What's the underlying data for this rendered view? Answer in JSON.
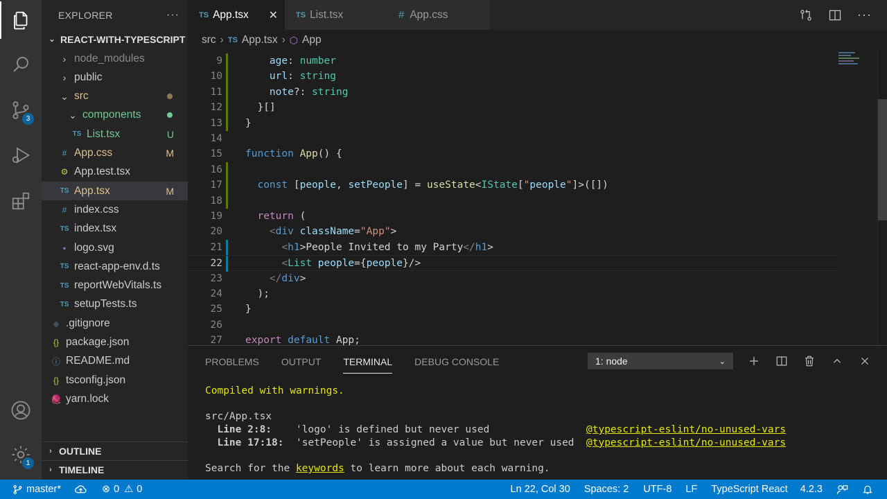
{
  "activity": {
    "scm_badge": "3",
    "settings_badge": "1"
  },
  "sidebar": {
    "title": "EXPLORER",
    "more": "···",
    "project": "REACT-WITH-TYPESCRIPT",
    "items": [
      {
        "label": "node_modules",
        "icon": "›",
        "color": "#8b8b8b",
        "status": ""
      },
      {
        "label": "public",
        "icon": "›",
        "color": "#cccccc",
        "status": ""
      },
      {
        "label": "src",
        "icon": "⌄",
        "color": "#e2c08d",
        "status": "dot"
      },
      {
        "label": "components",
        "icon": "⌄",
        "color": "#73c991",
        "status": "dot"
      },
      {
        "label": "List.tsx",
        "icon": "TS",
        "color": "#73c991",
        "status": "U"
      },
      {
        "label": "App.css",
        "icon": "#",
        "color": "#e2c08d",
        "status": "M"
      },
      {
        "label": "App.test.tsx",
        "icon": "⚙",
        "color": "#cccccc",
        "status": ""
      },
      {
        "label": "App.tsx",
        "icon": "TS",
        "color": "#e2c08d",
        "status": "M"
      },
      {
        "label": "index.css",
        "icon": "#",
        "color": "#cccccc",
        "status": ""
      },
      {
        "label": "index.tsx",
        "icon": "TS",
        "color": "#cccccc",
        "status": ""
      },
      {
        "label": "logo.svg",
        "icon": "▪",
        "color": "#cccccc",
        "status": ""
      },
      {
        "label": "react-app-env.d.ts",
        "icon": "TS",
        "color": "#cccccc",
        "status": ""
      },
      {
        "label": "reportWebVitals.ts",
        "icon": "TS",
        "color": "#cccccc",
        "status": ""
      },
      {
        "label": "setupTests.ts",
        "icon": "TS",
        "color": "#cccccc",
        "status": ""
      },
      {
        "label": ".gitignore",
        "icon": "◆",
        "color": "#cccccc",
        "status": ""
      },
      {
        "label": "package.json",
        "icon": "{}",
        "color": "#cccccc",
        "status": ""
      },
      {
        "label": "README.md",
        "icon": "ⓘ",
        "color": "#cccccc",
        "status": ""
      },
      {
        "label": "tsconfig.json",
        "icon": "{}",
        "color": "#cccccc",
        "status": ""
      },
      {
        "label": "yarn.lock",
        "icon": "🧶",
        "color": "#cccccc",
        "status": ""
      }
    ],
    "outline": "OUTLINE",
    "timeline": "TIMELINE"
  },
  "tabs": [
    {
      "label": "App.tsx",
      "prefix": "TS",
      "close": "✕"
    },
    {
      "label": "List.tsx",
      "prefix": "TS"
    },
    {
      "label": "App.css",
      "prefix": "#"
    }
  ],
  "breadcrumb": {
    "folder": "src",
    "file_prefix": "TS",
    "file": "App.tsx",
    "symbol": "App"
  },
  "editor": {
    "lines": [
      {
        "n": "9",
        "t": "    age: number"
      },
      {
        "n": "10",
        "t": "    url: string"
      },
      {
        "n": "11",
        "t": "    note?: string"
      },
      {
        "n": "12",
        "t": "  }[]"
      },
      {
        "n": "13",
        "t": "}"
      },
      {
        "n": "14",
        "t": ""
      },
      {
        "n": "15",
        "t": "function App() {"
      },
      {
        "n": "16",
        "t": ""
      },
      {
        "n": "17",
        "t": "  const [people, setPeople] = useState<IState[\"people\"]>([])"
      },
      {
        "n": "18",
        "t": ""
      },
      {
        "n": "19",
        "t": "  return ("
      },
      {
        "n": "20",
        "t": "    <div className=\"App\">"
      },
      {
        "n": "21",
        "t": "      <h1>People Invited to my Party</h1>"
      },
      {
        "n": "22",
        "t": "      <List people={people}/>"
      },
      {
        "n": "23",
        "t": "    </div>"
      },
      {
        "n": "24",
        "t": "  );"
      },
      {
        "n": "25",
        "t": "}"
      },
      {
        "n": "26",
        "t": ""
      },
      {
        "n": "27",
        "t": "export default App;"
      }
    ]
  },
  "panel": {
    "tabs": [
      "PROBLEMS",
      "OUTPUT",
      "TERMINAL",
      "DEBUG CONSOLE"
    ],
    "terminal_select": "1: node",
    "terminal": {
      "l1": "Compiled with warnings.",
      "l2": "src/App.tsx",
      "w1_loc": "  Line 2:8:  ",
      "w1_msg": "  'logo' is defined but never used                ",
      "w1_rule": "@typescript-eslint/no-unused-vars",
      "w2_loc": "  Line 17:18:",
      "w2_msg": "  'setPeople' is assigned a value but never used  ",
      "w2_rule": "@typescript-eslint/no-unused-vars",
      "l5a": "Search for the ",
      "l5b": "keywords",
      "l5c": " to learn more about each warning."
    }
  },
  "status": {
    "branch": "master*",
    "errors": "0",
    "warnings": "0",
    "position": "Ln 22, Col 30",
    "spaces": "Spaces: 2",
    "encoding": "UTF-8",
    "eol": "LF",
    "language": "TypeScript React",
    "version": "4.2.3"
  }
}
